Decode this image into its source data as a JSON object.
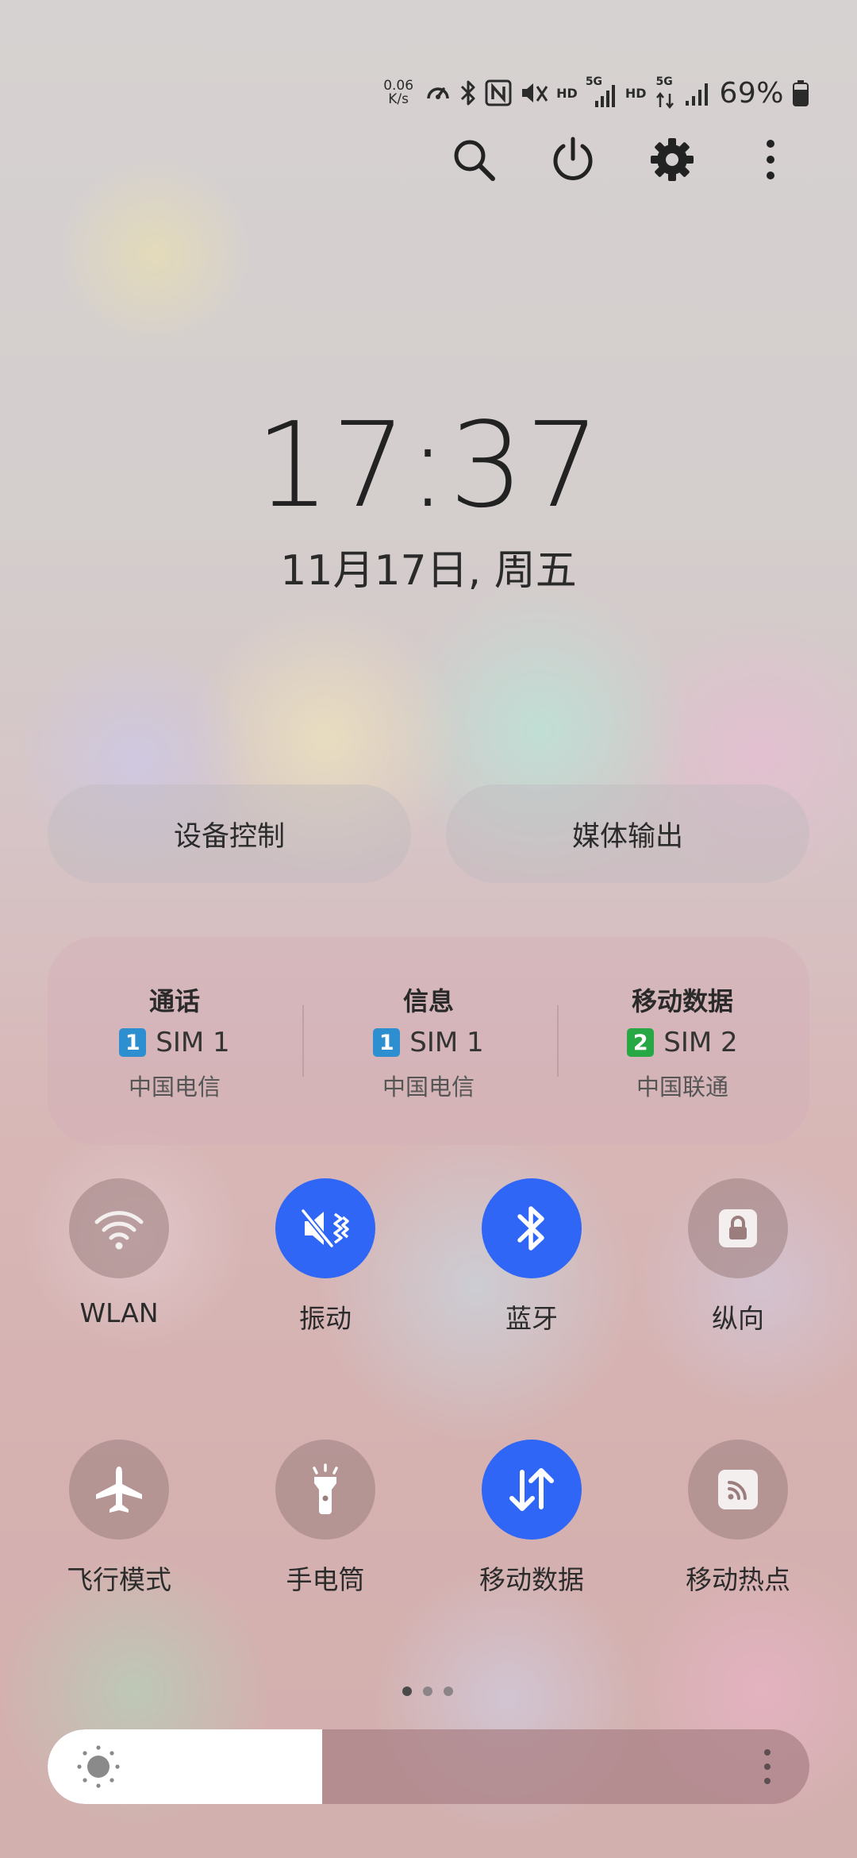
{
  "status_bar": {
    "net_speed_value": "0.06",
    "net_speed_unit": "K/s",
    "hd1": "HD",
    "sig1_label": "5G",
    "hd2": "HD",
    "sig2_label": "5G",
    "battery_text": "69%",
    "battery_level": 0.69,
    "icons": [
      "speed-meter-icon",
      "bluetooth-icon",
      "nfc-icon",
      "vibrate-mute-icon",
      "signal-icon",
      "battery-icon"
    ]
  },
  "top_actions": [
    "search-icon",
    "power-icon",
    "settings-gear-icon",
    "more-vert-icon"
  ],
  "clock": {
    "time": "17:37",
    "date": "11月17日, 周五"
  },
  "quick_buttons": {
    "device_control": "设备控制",
    "media_output": "媒体输出"
  },
  "sim_panel": {
    "columns": [
      {
        "title": "通话",
        "badge": "1",
        "sim": "SIM 1",
        "carrier": "中国电信",
        "badge_color": "#2d8fd0"
      },
      {
        "title": "信息",
        "badge": "1",
        "sim": "SIM 1",
        "carrier": "中国电信",
        "badge_color": "#2d8fd0"
      },
      {
        "title": "移动数据",
        "badge": "2",
        "sim": "SIM 2",
        "carrier": "中国联通",
        "badge_color": "#27a844"
      }
    ]
  },
  "toggles": [
    {
      "label": "WLAN",
      "icon": "wifi-icon",
      "active": false
    },
    {
      "label": "振动",
      "icon": "vibrate-icon",
      "active": true
    },
    {
      "label": "蓝牙",
      "icon": "bluetooth-icon",
      "active": true
    },
    {
      "label": "纵向",
      "icon": "portrait-lock-icon",
      "active": false
    },
    {
      "label": "飞行模式",
      "icon": "airplane-icon",
      "active": false
    },
    {
      "label": "手电筒",
      "icon": "flashlight-icon",
      "active": false
    },
    {
      "label": "移动数据",
      "icon": "mobile-data-icon",
      "active": true
    },
    {
      "label": "移动热点",
      "icon": "hotspot-icon",
      "active": false
    }
  ],
  "pager": {
    "pages": 3,
    "current": 1
  },
  "brightness": {
    "level": 0.36
  },
  "colors": {
    "accent": "#2f66f5",
    "tile_off": "#9b7d7d"
  }
}
